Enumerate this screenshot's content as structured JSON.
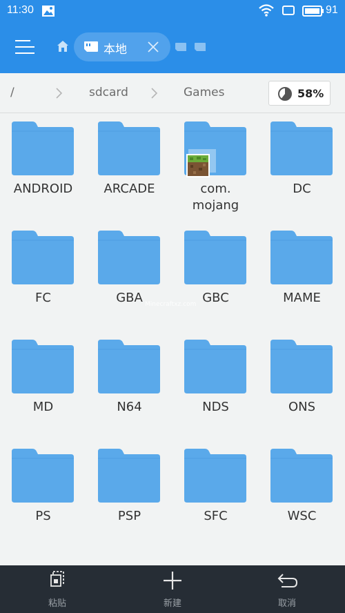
{
  "status_bar": {
    "time": "11:30",
    "battery": "91",
    "icons": [
      "image-icon",
      "wifi-icon",
      "rotate-icon",
      "battery-icon"
    ]
  },
  "header": {
    "tab_label": "本地",
    "icons": [
      "menu-icon",
      "home-icon",
      "sdcard-icon",
      "close-icon"
    ]
  },
  "breadcrumb": {
    "items": [
      "/",
      "sdcard",
      "Games"
    ],
    "storage_used": "58%"
  },
  "folders": [
    {
      "name": "ANDROID"
    },
    {
      "name": "ARCADE"
    },
    {
      "name": "com.\nmojang"
    },
    {
      "name": "DC"
    },
    {
      "name": "FC"
    },
    {
      "name": "GBA"
    },
    {
      "name": "GBC"
    },
    {
      "name": "MAME"
    },
    {
      "name": "MD"
    },
    {
      "name": "N64"
    },
    {
      "name": "NDS"
    },
    {
      "name": "ONS"
    },
    {
      "name": "PS"
    },
    {
      "name": "PSP"
    },
    {
      "name": "SFC"
    },
    {
      "name": "WSC"
    }
  ],
  "watermark": "Minecraftxz.com",
  "bottom_bar": {
    "paste": "粘贴",
    "new": "新建",
    "cancel": "取消"
  },
  "colors": {
    "accent": "#2b8ee8",
    "folder": "#5aa9ea",
    "folder_dark": "#4d9de2",
    "bottom_bar": "#262d35"
  }
}
